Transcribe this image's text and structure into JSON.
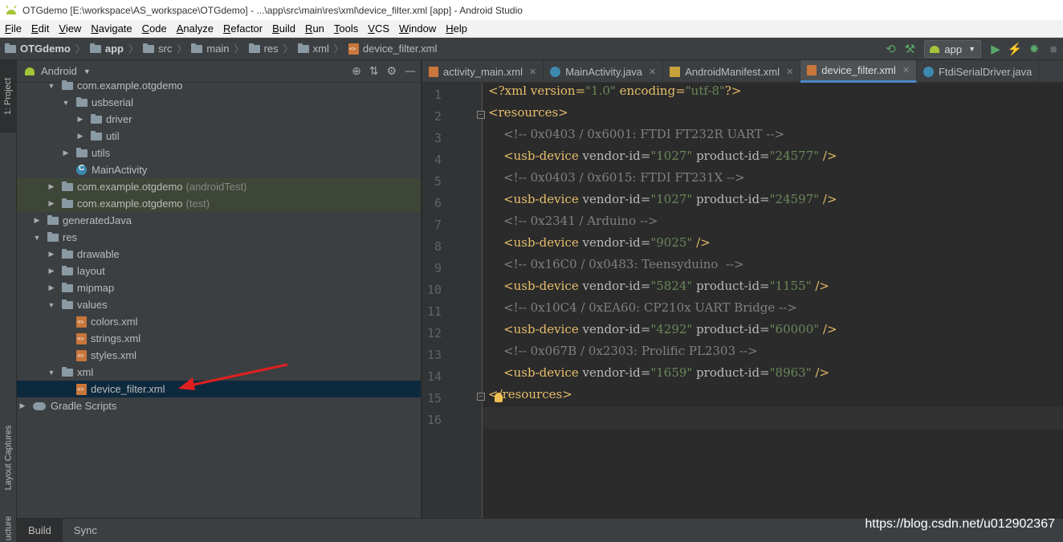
{
  "window": {
    "title": "OTGdemo [E:\\workspace\\AS_workspace\\OTGdemo] - ...\\app\\src\\main\\res\\xml\\device_filter.xml [app] - Android Studio"
  },
  "menu": [
    "File",
    "Edit",
    "View",
    "Navigate",
    "Code",
    "Analyze",
    "Refactor",
    "Build",
    "Run",
    "Tools",
    "VCS",
    "Window",
    "Help"
  ],
  "breadcrumb": [
    "OTGdemo",
    "app",
    "src",
    "main",
    "res",
    "xml",
    "device_filter.xml"
  ],
  "toolbar": {
    "run_config": "app"
  },
  "left_strip": {
    "project": "1: Project",
    "captures": "Layout Captures",
    "structure": "ucture"
  },
  "project_panel": {
    "view_mode": "Android",
    "tree": [
      {
        "label": "com.example.otgdemo",
        "suffix": ""
      },
      {
        "label": "usbserial",
        "suffix": ""
      },
      {
        "label": "driver",
        "suffix": ""
      },
      {
        "label": "util",
        "suffix": ""
      },
      {
        "label": "utils",
        "suffix": ""
      },
      {
        "label": "MainActivity",
        "suffix": ""
      },
      {
        "label": "com.example.otgdemo",
        "suffix": "(androidTest)"
      },
      {
        "label": "com.example.otgdemo",
        "suffix": "(test)"
      },
      {
        "label": "generatedJava",
        "suffix": ""
      },
      {
        "label": "res",
        "suffix": ""
      },
      {
        "label": "drawable",
        "suffix": ""
      },
      {
        "label": "layout",
        "suffix": ""
      },
      {
        "label": "mipmap",
        "suffix": ""
      },
      {
        "label": "values",
        "suffix": ""
      },
      {
        "label": "colors.xml",
        "suffix": ""
      },
      {
        "label": "strings.xml",
        "suffix": ""
      },
      {
        "label": "styles.xml",
        "suffix": ""
      },
      {
        "label": "xml",
        "suffix": ""
      },
      {
        "label": "device_filter.xml",
        "suffix": ""
      },
      {
        "label": "Gradle Scripts",
        "suffix": ""
      }
    ]
  },
  "editor": {
    "tabs": [
      "activity_main.xml",
      "MainActivity.java",
      "AndroidManifest.xml",
      "device_filter.xml",
      "FtdiSerialDriver.java"
    ],
    "active_tab": "device_filter.xml",
    "line_numbers": [
      "1",
      "2",
      "3",
      "4",
      "5",
      "6",
      "7",
      "8",
      "9",
      "10",
      "11",
      "12",
      "13",
      "14",
      "15",
      "16"
    ],
    "lines": [
      [
        {
          "t": "<?xml version=",
          "c": "pi"
        },
        {
          "t": "\"1.0\"",
          "c": "val"
        },
        {
          "t": " encoding=",
          "c": "pi"
        },
        {
          "t": "\"utf-8\"",
          "c": "val"
        },
        {
          "t": "?>",
          "c": "pi"
        }
      ],
      [
        {
          "t": "<resources>",
          "c": "tag"
        }
      ],
      [
        {
          "t": "    <!-- 0x0403 / 0x6001: FTDI FT232R UART -->",
          "c": "cmt"
        }
      ],
      [
        {
          "t": "    <usb-device ",
          "c": "tag"
        },
        {
          "t": "vendor-id=",
          "c": "attr"
        },
        {
          "t": "\"1027\"",
          "c": "val"
        },
        {
          "t": " product-id=",
          "c": "attr"
        },
        {
          "t": "\"24577\"",
          "c": "val"
        },
        {
          "t": " />",
          "c": "tag"
        }
      ],
      [
        {
          "t": "    <!-- 0x0403 / 0x6015: FTDI FT231X -->",
          "c": "cmt"
        }
      ],
      [
        {
          "t": "    <usb-device ",
          "c": "tag"
        },
        {
          "t": "vendor-id=",
          "c": "attr"
        },
        {
          "t": "\"1027\"",
          "c": "val"
        },
        {
          "t": " product-id=",
          "c": "attr"
        },
        {
          "t": "\"24597\"",
          "c": "val"
        },
        {
          "t": " />",
          "c": "tag"
        }
      ],
      [
        {
          "t": "    <!-- 0x2341 / Arduino -->",
          "c": "cmt"
        }
      ],
      [
        {
          "t": "    <usb-device ",
          "c": "tag"
        },
        {
          "t": "vendor-id=",
          "c": "attr"
        },
        {
          "t": "\"9025\"",
          "c": "val"
        },
        {
          "t": " />",
          "c": "tag"
        }
      ],
      [
        {
          "t": "    <!-- 0x16C0 / 0x0483: Teensyduino  -->",
          "c": "cmt"
        }
      ],
      [
        {
          "t": "    <usb-device ",
          "c": "tag"
        },
        {
          "t": "vendor-id=",
          "c": "attr"
        },
        {
          "t": "\"5824\"",
          "c": "val"
        },
        {
          "t": " product-id=",
          "c": "attr"
        },
        {
          "t": "\"1155\"",
          "c": "val"
        },
        {
          "t": " />",
          "c": "tag"
        }
      ],
      [
        {
          "t": "    <!-- 0x10C4 / 0xEA60: CP210x UART Bridge -->",
          "c": "cmt"
        }
      ],
      [
        {
          "t": "    <usb-device ",
          "c": "tag"
        },
        {
          "t": "vendor-id=",
          "c": "attr"
        },
        {
          "t": "\"4292\"",
          "c": "val"
        },
        {
          "t": " product-id=",
          "c": "attr"
        },
        {
          "t": "\"60000\"",
          "c": "val"
        },
        {
          "t": " />",
          "c": "tag"
        }
      ],
      [
        {
          "t": "    <!-- 0x067B / 0x2303: Prolific PL2303 -->",
          "c": "cmt"
        }
      ],
      [
        {
          "t": "    <usb-device ",
          "c": "tag"
        },
        {
          "t": "vendor-id=",
          "c": "attr"
        },
        {
          "t": "\"1659\"",
          "c": "val"
        },
        {
          "t": " product-id=",
          "c": "attr"
        },
        {
          "t": "\"8963\"",
          "c": "val"
        },
        {
          "t": " />",
          "c": "tag"
        }
      ],
      [
        {
          "t": "</resources>",
          "c": "tag"
        }
      ],
      []
    ]
  },
  "bottom_tabs": [
    "Build",
    "Sync"
  ],
  "watermark": "https://blog.csdn.net/u012902367",
  "colors": {
    "accent": "#4a88c7",
    "selection": "#0d293e",
    "arrow": "#e02020"
  }
}
